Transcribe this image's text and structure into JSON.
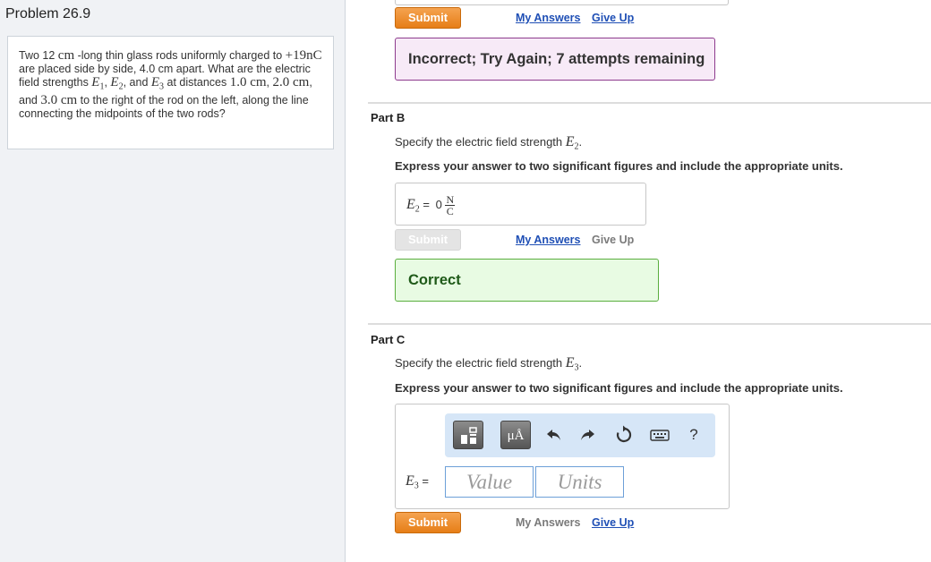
{
  "problem": {
    "title": "Problem 26.9",
    "text": {
      "t1": "Two 12 ",
      "u_cm": "cm",
      "t2": " -long thin glass rods uniformly charged to ",
      "charge": "+19nC",
      "t3": " are placed side by side, 4.0 cm apart. What are the electric field strengths ",
      "e1": "E",
      "e1sub": "1",
      "sep1": ", ",
      "e2": "E",
      "e2sub": "2",
      "sep2": ", and ",
      "e3": "E",
      "e3sub": "3",
      "t4": " at distances ",
      "d1": "1.0 cm",
      "sep3": ", ",
      "d2": "2.0 cm",
      "sep4": ", and ",
      "d3": "3.0 cm",
      "t5": " to the right of the rod on the left, along the line connecting the midpoints of the two rods?"
    }
  },
  "part_a": {
    "submit_label": "Submit",
    "my_answers": "My Answers",
    "give_up": "Give Up",
    "feedback": "Incorrect; Try Again; 7 attempts remaining"
  },
  "part_b": {
    "title": "Part B",
    "prompt": "Specify the electric field strength ",
    "var": "E",
    "var_sub": "2",
    "prompt_end": ".",
    "instructions": "Express your answer to two significant figures and include the appropriate units.",
    "answer_label_var": "E",
    "answer_label_sub": "2",
    "answer_eq": " = ",
    "answer_value": "0",
    "unit_num": "N",
    "unit_den": "C",
    "submit_label": "Submit",
    "my_answers": "My Answers",
    "give_up": "Give Up",
    "feedback": "Correct"
  },
  "part_c": {
    "title": "Part C",
    "prompt": "Specify the electric field strength ",
    "var": "E",
    "var_sub": "3",
    "prompt_end": ".",
    "instructions": "Express your answer to two significant figures and include the appropriate units.",
    "toolbar": {
      "units_label": "μÅ",
      "help_label": "?"
    },
    "answer_label_var": "E",
    "answer_label_sub": "3",
    "answer_eq": " = ",
    "value_placeholder": "Value",
    "units_placeholder": "Units",
    "submit_label": "Submit",
    "my_answers": "My Answers",
    "give_up": "Give Up"
  },
  "colors": {
    "submit_orange": "#e67e17",
    "link_blue": "#1f4fb5",
    "incorrect_bg": "#f7eaf7",
    "correct_bg": "#e8fbe3",
    "toolbar_bg": "#d6e6f7"
  }
}
